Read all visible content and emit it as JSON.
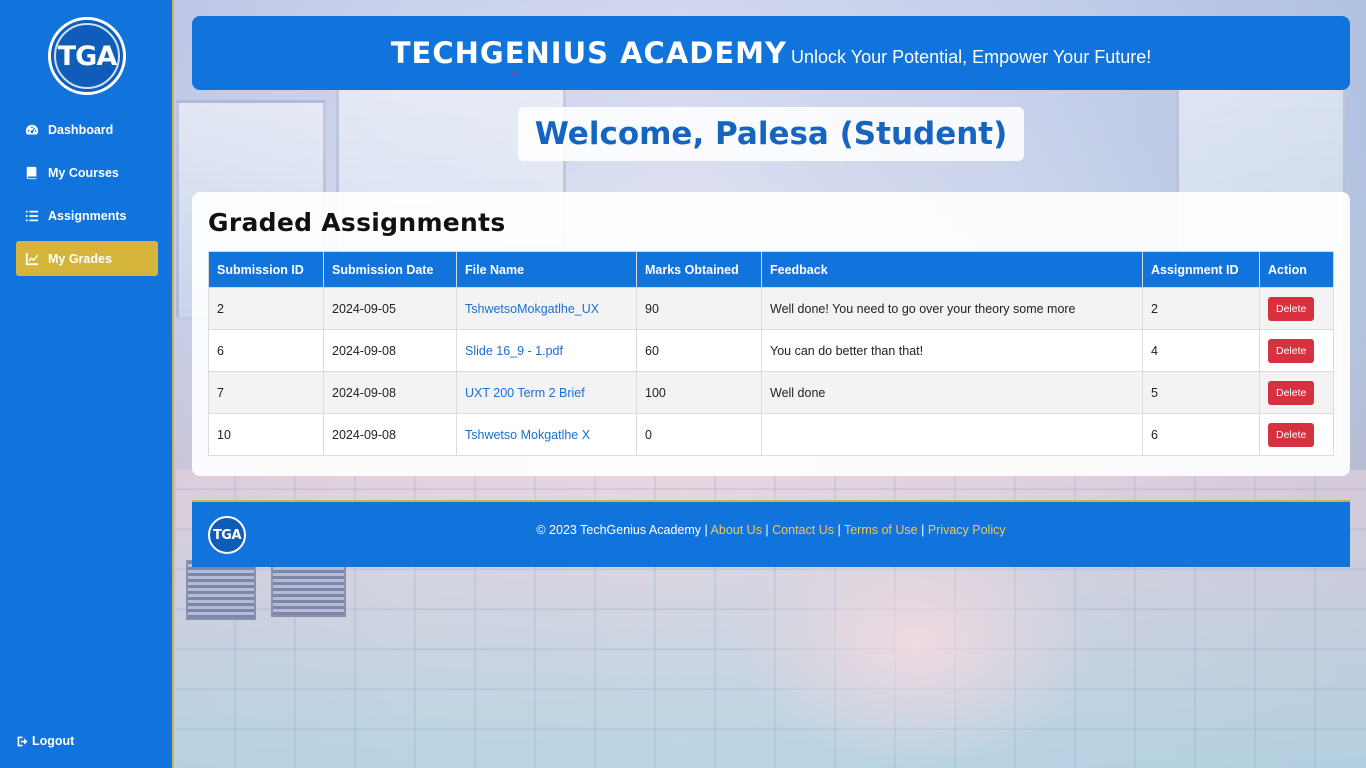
{
  "sidebar": {
    "logo_text": "TGA",
    "items": [
      {
        "label": "Dashboard",
        "icon": "dashboard-icon"
      },
      {
        "label": "My Courses",
        "icon": "book-icon"
      },
      {
        "label": "Assignments",
        "icon": "list-icon"
      },
      {
        "label": "My Grades",
        "icon": "chart-icon",
        "active": true
      }
    ],
    "logout_label": "Logout"
  },
  "header": {
    "brand": "TECHGENIUS ACADEMY",
    "tagline": "Unlock Your Potential, Empower Your Future!"
  },
  "welcome": "Welcome, Palesa (Student)",
  "grades": {
    "title": "Graded Assignments",
    "columns": [
      "Submission ID",
      "Submission Date",
      "File Name",
      "Marks Obtained",
      "Feedback",
      "Assignment ID",
      "Action"
    ],
    "rows": [
      {
        "id": "2",
        "date": "2024-09-05",
        "file": "TshwetsoMokgatlhe_UX",
        "marks": "90",
        "feedback": "Well done! You need to go over your theory some more",
        "assignment_id": "2",
        "action": "Delete"
      },
      {
        "id": "6",
        "date": "2024-09-08",
        "file": "Slide 16_9 - 1.pdf",
        "marks": "60",
        "feedback": "You can do better than that!",
        "assignment_id": "4",
        "action": "Delete"
      },
      {
        "id": "7",
        "date": "2024-09-08",
        "file": "UXT 200 Term 2 Brief",
        "marks": "100",
        "feedback": "Well done",
        "assignment_id": "5",
        "action": "Delete"
      },
      {
        "id": "10",
        "date": "2024-09-08",
        "file": "Tshwetso Mokgatlhe X",
        "marks": "0",
        "feedback": "",
        "assignment_id": "6",
        "action": "Delete"
      }
    ]
  },
  "footer": {
    "logo_text": "TGA",
    "copyright": "© 2023 TechGenius Academy",
    "links": [
      "About Us",
      "Contact Us",
      "Terms of Use",
      "Privacy Policy"
    ]
  },
  "colors": {
    "primary": "#1173dc",
    "active_nav": "#d4b53a",
    "delete": "#d7303f",
    "footer_link": "#f2c94c"
  }
}
